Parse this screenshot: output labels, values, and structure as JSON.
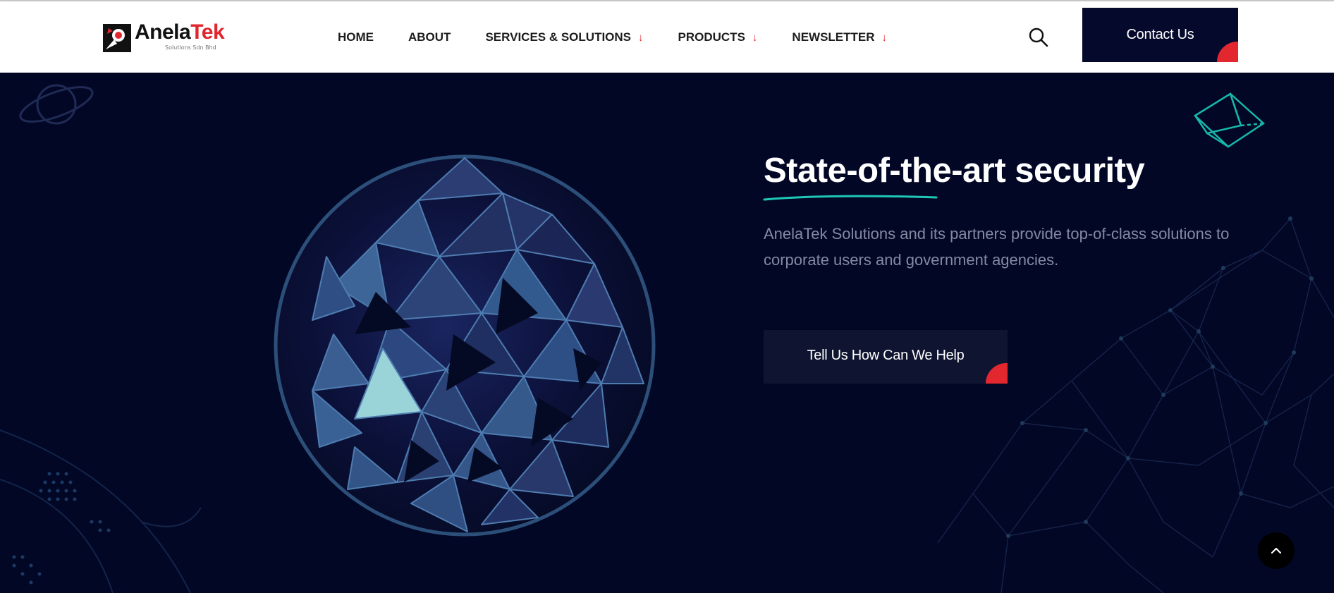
{
  "brand": {
    "name_part1": "Anela",
    "name_part2": "Tek",
    "tagline": "Solutions Sdn Bhd",
    "colors": {
      "navy": "#020725",
      "accent_red": "#e2272f",
      "accent_teal": "#1ec7b6"
    }
  },
  "nav": {
    "items": [
      {
        "label": "HOME",
        "has_dropdown": false
      },
      {
        "label": "ABOUT",
        "has_dropdown": false
      },
      {
        "label": "SERVICES & SOLUTIONS",
        "has_dropdown": true,
        "dropdown_icon": "arrow-down-icon"
      },
      {
        "label": "PRODUCTS",
        "has_dropdown": true,
        "dropdown_icon": "arrow-down-icon"
      },
      {
        "label": "NEWSLETTER",
        "has_dropdown": true,
        "dropdown_icon": "arrow-down-icon"
      }
    ],
    "dropdown_arrow": "↓",
    "search_icon": "search-icon",
    "contact_label": "Contact Us"
  },
  "hero": {
    "title": "State-of-the-art security",
    "description": "AnelaTek Solutions and its partners provide top-of-class solutions to corporate users and government agencies.",
    "cta_label": "Tell Us How Can We Help",
    "image": "geodesic-sphere-illustration"
  },
  "scroll_top": {
    "icon": "chevron-up-icon"
  }
}
